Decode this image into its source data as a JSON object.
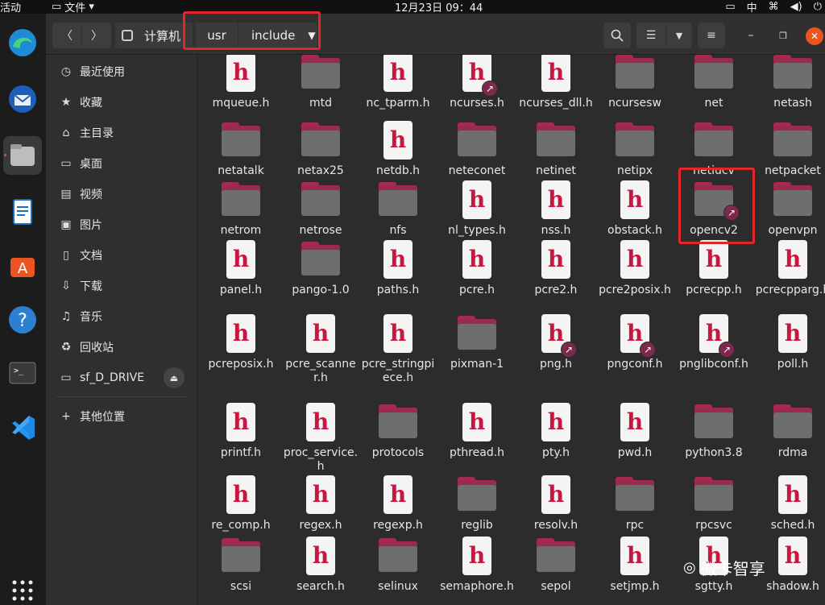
{
  "topbar": {
    "activities": "活动",
    "app_menu": "文件",
    "clock": "12月23日  09：44",
    "input_method": "中"
  },
  "header": {
    "location_root": "计算机",
    "path": [
      "usr",
      "include"
    ]
  },
  "sidebar": {
    "items": [
      {
        "label": "最近使用",
        "icon": "clock-icon"
      },
      {
        "label": "收藏",
        "icon": "star-icon"
      },
      {
        "label": "主目录",
        "icon": "home-icon"
      },
      {
        "label": "桌面",
        "icon": "desktop-icon"
      },
      {
        "label": "视频",
        "icon": "video-icon"
      },
      {
        "label": "图片",
        "icon": "picture-icon"
      },
      {
        "label": "文档",
        "icon": "document-icon"
      },
      {
        "label": "下载",
        "icon": "download-icon"
      },
      {
        "label": "音乐",
        "icon": "music-icon"
      },
      {
        "label": "回收站",
        "icon": "trash-icon"
      },
      {
        "label": "sf_D_DRIVE",
        "icon": "drive-icon"
      },
      {
        "label": "其他位置",
        "icon": "plus-icon"
      }
    ]
  },
  "files": [
    {
      "name": "mqueue.h",
      "type": "header"
    },
    {
      "name": "mtd",
      "type": "folder"
    },
    {
      "name": "nc_tparm.h",
      "type": "header"
    },
    {
      "name": "ncurses.h",
      "type": "header",
      "link": true
    },
    {
      "name": "ncurses_dll.h",
      "type": "header"
    },
    {
      "name": "ncursesw",
      "type": "folder"
    },
    {
      "name": "net",
      "type": "folder"
    },
    {
      "name": "netash",
      "type": "folder"
    },
    {
      "name": "netatalk",
      "type": "folder"
    },
    {
      "name": "netax25",
      "type": "folder"
    },
    {
      "name": "netdb.h",
      "type": "header"
    },
    {
      "name": "neteconet",
      "type": "folder"
    },
    {
      "name": "netinet",
      "type": "folder"
    },
    {
      "name": "netipx",
      "type": "folder"
    },
    {
      "name": "netiucv",
      "type": "folder"
    },
    {
      "name": "netpacket",
      "type": "folder"
    },
    {
      "name": "netrom",
      "type": "folder"
    },
    {
      "name": "netrose",
      "type": "folder"
    },
    {
      "name": "nfs",
      "type": "folder"
    },
    {
      "name": "nl_types.h",
      "type": "header"
    },
    {
      "name": "nss.h",
      "type": "header"
    },
    {
      "name": "obstack.h",
      "type": "header"
    },
    {
      "name": "opencv2",
      "type": "folder",
      "link": true
    },
    {
      "name": "openvpn",
      "type": "folder"
    },
    {
      "name": "panel.h",
      "type": "header"
    },
    {
      "name": "pango-1.0",
      "type": "folder"
    },
    {
      "name": "paths.h",
      "type": "header"
    },
    {
      "name": "pcre.h",
      "type": "header"
    },
    {
      "name": "pcre2.h",
      "type": "header"
    },
    {
      "name": "pcre2posix.h",
      "type": "header"
    },
    {
      "name": "pcrecpp.h",
      "type": "header"
    },
    {
      "name": "pcrecpparg.h",
      "type": "header"
    },
    {
      "name": "pcreposix.h",
      "type": "header"
    },
    {
      "name": "pcre_scanner.h",
      "type": "header"
    },
    {
      "name": "pcre_stringpiece.h",
      "type": "header"
    },
    {
      "name": "pixman-1",
      "type": "folder"
    },
    {
      "name": "png.h",
      "type": "header",
      "link": true
    },
    {
      "name": "pngconf.h",
      "type": "header",
      "link": true
    },
    {
      "name": "pnglibconf.h",
      "type": "header",
      "link": true
    },
    {
      "name": "poll.h",
      "type": "header"
    },
    {
      "name": "printf.h",
      "type": "header"
    },
    {
      "name": "proc_service.h",
      "type": "header"
    },
    {
      "name": "protocols",
      "type": "folder"
    },
    {
      "name": "pthread.h",
      "type": "header"
    },
    {
      "name": "pty.h",
      "type": "header"
    },
    {
      "name": "pwd.h",
      "type": "header"
    },
    {
      "name": "python3.8",
      "type": "folder"
    },
    {
      "name": "rdma",
      "type": "folder"
    },
    {
      "name": "re_comp.h",
      "type": "header"
    },
    {
      "name": "regex.h",
      "type": "header"
    },
    {
      "name": "regexp.h",
      "type": "header"
    },
    {
      "name": "reglib",
      "type": "folder"
    },
    {
      "name": "resolv.h",
      "type": "header"
    },
    {
      "name": "rpc",
      "type": "folder"
    },
    {
      "name": "rpcsvc",
      "type": "folder"
    },
    {
      "name": "sched.h",
      "type": "header"
    },
    {
      "name": "scsi",
      "type": "folder"
    },
    {
      "name": "search.h",
      "type": "header"
    },
    {
      "name": "selinux",
      "type": "folder"
    },
    {
      "name": "semaphore.h",
      "type": "header"
    },
    {
      "name": "sepol",
      "type": "folder"
    },
    {
      "name": "setjmp.h",
      "type": "header"
    },
    {
      "name": "sgtty.h",
      "type": "header"
    },
    {
      "name": "shadow.h",
      "type": "header"
    }
  ],
  "watermark": "微卡智享"
}
